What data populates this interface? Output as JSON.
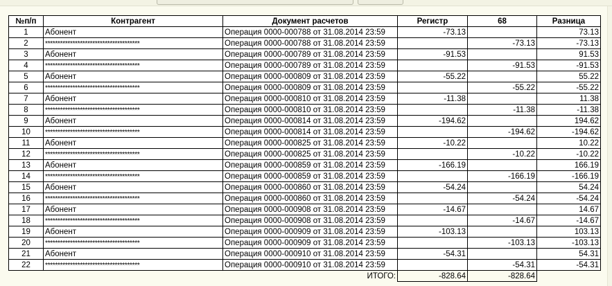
{
  "table": {
    "headers": [
      "№п/п",
      "Контрагент",
      "Документ расчетов",
      "Регистр",
      "68",
      "Разница"
    ],
    "rows": [
      {
        "n": "1",
        "agent": "Абонент",
        "doc": "Операция 0000-000788 от 31.08.2014 23:59",
        "reg": "-73.13",
        "c68": "",
        "diff": "73.13"
      },
      {
        "n": "2",
        "agent": "**************************************",
        "doc": "Операция 0000-000788 от 31.08.2014 23:59",
        "reg": "",
        "c68": "-73.13",
        "diff": "-73.13"
      },
      {
        "n": "3",
        "agent": "Абонент",
        "doc": "Операция 0000-000789 от 31.08.2014 23:59",
        "reg": "-91.53",
        "c68": "",
        "diff": "91.53"
      },
      {
        "n": "4",
        "agent": "**************************************",
        "doc": "Операция 0000-000789 от 31.08.2014 23:59",
        "reg": "",
        "c68": "-91.53",
        "diff": "-91.53"
      },
      {
        "n": "5",
        "agent": "Абонент",
        "doc": "Операция 0000-000809 от 31.08.2014 23:59",
        "reg": "-55.22",
        "c68": "",
        "diff": "55.22"
      },
      {
        "n": "6",
        "agent": "**************************************",
        "doc": "Операция 0000-000809 от 31.08.2014 23:59",
        "reg": "",
        "c68": "-55.22",
        "diff": "-55.22"
      },
      {
        "n": "7",
        "agent": "Абонент",
        "doc": "Операция 0000-000810 от 31.08.2014 23:59",
        "reg": "-11.38",
        "c68": "",
        "diff": "11.38"
      },
      {
        "n": "8",
        "agent": "**************************************",
        "doc": "Операция 0000-000810 от 31.08.2014 23:59",
        "reg": "",
        "c68": "-11.38",
        "diff": "-11.38"
      },
      {
        "n": "9",
        "agent": "Абонент",
        "doc": "Операция 0000-000814 от 31.08.2014 23:59",
        "reg": "-194.62",
        "c68": "",
        "diff": "194.62"
      },
      {
        "n": "10",
        "agent": "**************************************",
        "doc": "Операция 0000-000814 от 31.08.2014 23:59",
        "reg": "",
        "c68": "-194.62",
        "diff": "-194.62"
      },
      {
        "n": "11",
        "agent": "Абонент",
        "doc": "Операция 0000-000825 от 31.08.2014 23:59",
        "reg": "-10.22",
        "c68": "",
        "diff": "10.22"
      },
      {
        "n": "12",
        "agent": "**************************************",
        "doc": "Операция 0000-000825 от 31.08.2014 23:59",
        "reg": "",
        "c68": "-10.22",
        "diff": "-10.22"
      },
      {
        "n": "13",
        "agent": "Абонент",
        "doc": "Операция 0000-000859 от 31.08.2014 23:59",
        "reg": "-166.19",
        "c68": "",
        "diff": "166.19"
      },
      {
        "n": "14",
        "agent": "**************************************",
        "doc": "Операция 0000-000859 от 31.08.2014 23:59",
        "reg": "",
        "c68": "-166.19",
        "diff": "-166.19"
      },
      {
        "n": "15",
        "agent": "Абонент",
        "doc": "Операция 0000-000860 от 31.08.2014 23:59",
        "reg": "-54.24",
        "c68": "",
        "diff": "54.24"
      },
      {
        "n": "16",
        "agent": "**************************************",
        "doc": "Операция 0000-000860 от 31.08.2014 23:59",
        "reg": "",
        "c68": "-54.24",
        "diff": "-54.24"
      },
      {
        "n": "17",
        "agent": "Абонент",
        "doc": "Операция 0000-000908 от 31.08.2014 23:59",
        "reg": "-14.67",
        "c68": "",
        "diff": "14.67"
      },
      {
        "n": "18",
        "agent": "**************************************",
        "doc": "Операция 0000-000908 от 31.08.2014 23:59",
        "reg": "",
        "c68": "-14.67",
        "diff": "-14.67"
      },
      {
        "n": "19",
        "agent": "Абонент",
        "doc": "Операция 0000-000909 от 31.08.2014 23:59",
        "reg": "-103.13",
        "c68": "",
        "diff": "103.13"
      },
      {
        "n": "20",
        "agent": "**************************************",
        "doc": "Операция 0000-000909 от 31.08.2014 23:59",
        "reg": "",
        "c68": "-103.13",
        "diff": "-103.13"
      },
      {
        "n": "21",
        "agent": "Абонент",
        "doc": "Операция 0000-000910 от 31.08.2014 23:59",
        "reg": "-54.31",
        "c68": "",
        "diff": "54.31"
      },
      {
        "n": "22",
        "agent": "**************************************",
        "doc": "Операция 0000-000910 от 31.08.2014 23:59",
        "reg": "",
        "c68": "-54.31",
        "diff": "-54.31"
      }
    ],
    "total": {
      "label": "ИТОГО:",
      "reg": "-828.64",
      "c68": "-828.64"
    }
  }
}
